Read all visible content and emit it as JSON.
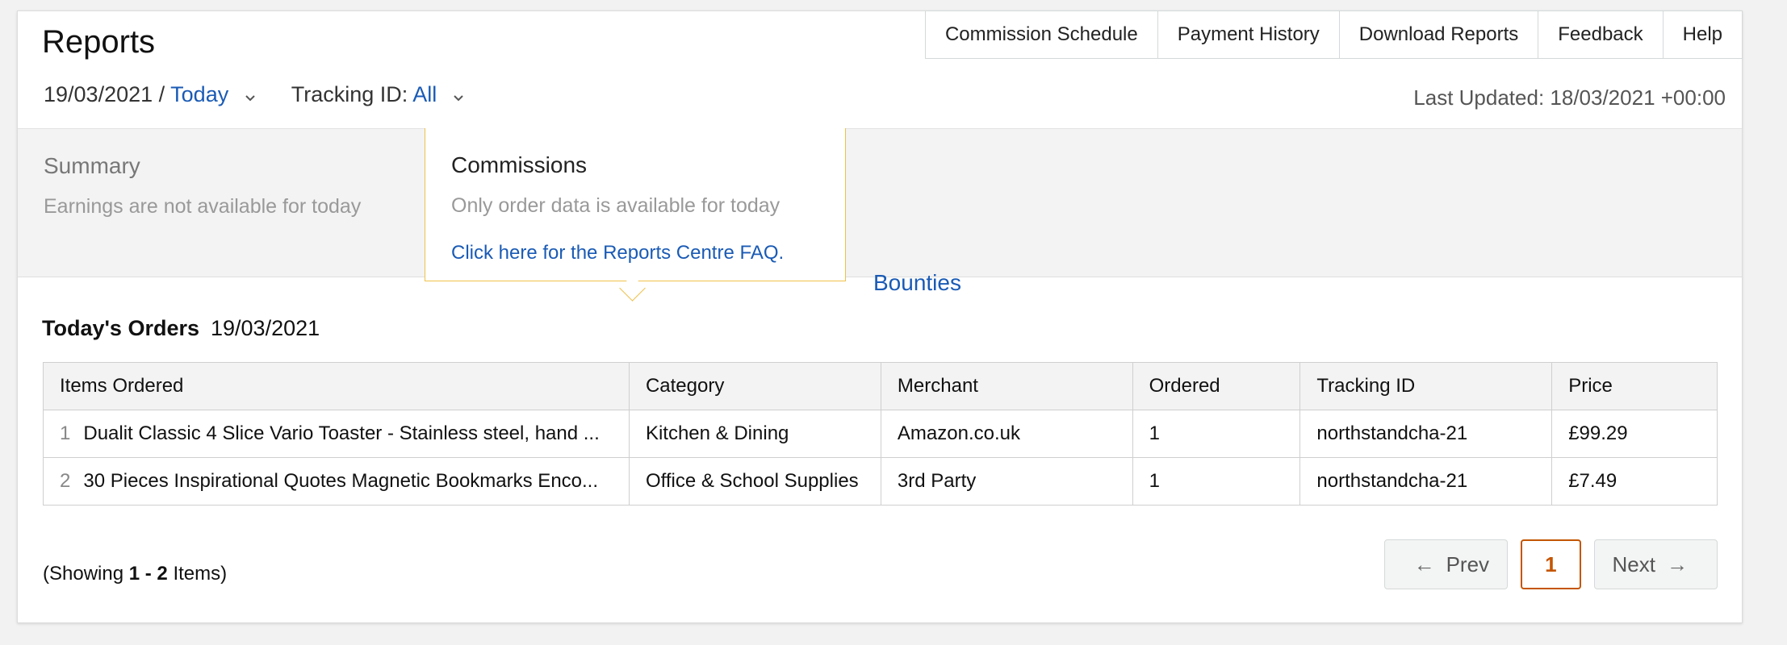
{
  "header": {
    "title": "Reports",
    "nav": [
      "Commission Schedule",
      "Payment History",
      "Download Reports",
      "Feedback",
      "Help"
    ]
  },
  "filters": {
    "date_prefix": "19/03/2021 /",
    "date_value": "Today",
    "tracking_label": "Tracking ID:",
    "tracking_value": "All"
  },
  "last_updated": "Last Updated: 18/03/2021 +00:00",
  "tabs": {
    "summary": {
      "title": "Summary",
      "sub": "Earnings are not available for today"
    },
    "commissions": {
      "title": "Commissions",
      "sub": "Only order data is available for today",
      "faq": "Click here for the Reports Centre FAQ."
    },
    "bounties": {
      "title": "Bounties"
    }
  },
  "orders": {
    "heading": "Today's Orders",
    "date": "19/03/2021",
    "columns": [
      "Items Ordered",
      "Category",
      "Merchant",
      "Ordered",
      "Tracking ID",
      "Price"
    ],
    "rows": [
      {
        "num": "1",
        "item": "Dualit Classic 4 Slice Vario Toaster - Stainless steel, hand ...",
        "category": "Kitchen & Dining",
        "merchant": "Amazon.co.uk",
        "ordered": "1",
        "tracking": "northstandcha-21",
        "price": "£99.29"
      },
      {
        "num": "2",
        "item": "30 Pieces Inspirational Quotes Magnetic Bookmarks Enco...",
        "category": "Office & School Supplies",
        "merchant": "3rd Party",
        "ordered": "1",
        "tracking": "northstandcha-21",
        "price": "£7.49"
      }
    ]
  },
  "pagination": {
    "showing_prefix": "(Showing",
    "showing_range": "1 - 2",
    "showing_suffix": "Items)",
    "prev_arrow": "←",
    "prev": "Prev",
    "current": "1",
    "next": "Next",
    "next_arrow": "→"
  },
  "colors": {
    "link": "#1a5bb5",
    "accent": "#c45500",
    "highlight_border": "#f0c14b"
  },
  "icons": {
    "dropdown": "chevron-down-icon",
    "prev": "arrow-left-icon",
    "next": "arrow-right-icon"
  }
}
